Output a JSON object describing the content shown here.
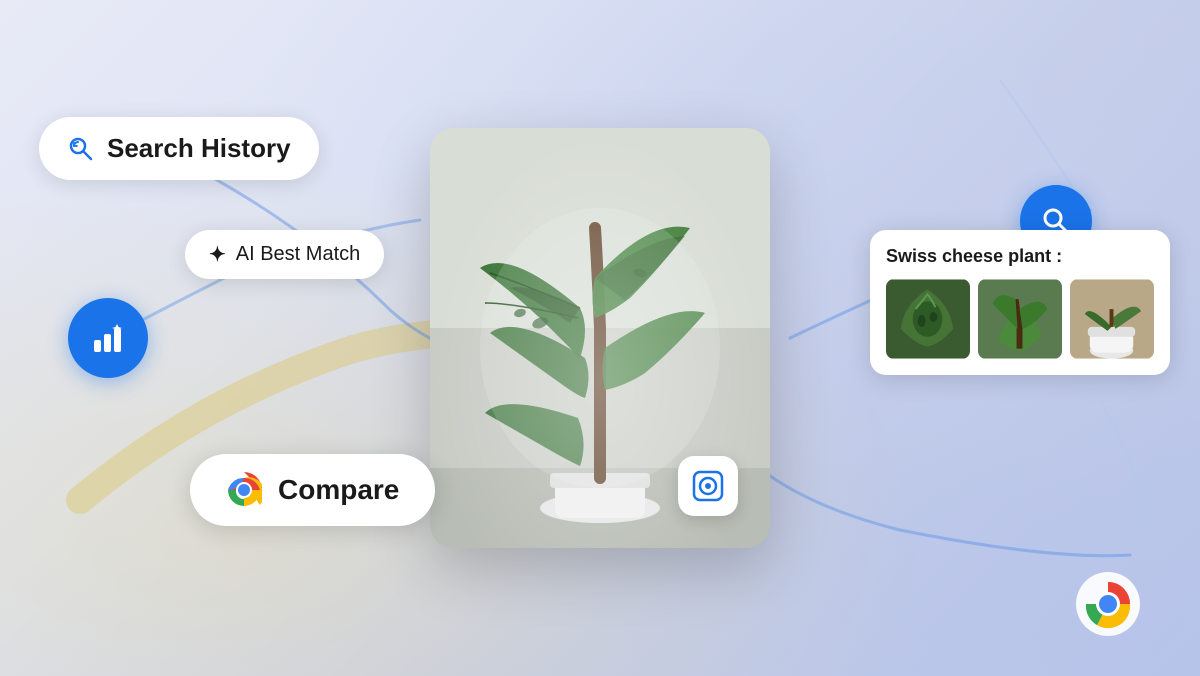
{
  "background": {
    "colors": {
      "primary": "#dde3f5",
      "secondary": "#c5cde8",
      "accent_warm": "rgba(232,220,170,0.45)",
      "accent_blue": "#1a73e8"
    }
  },
  "search_history_pill": {
    "label": "Search History",
    "icon": "search-history-icon"
  },
  "ai_best_match_pill": {
    "label": "AI Best Match",
    "icon": "sparkle-icon"
  },
  "compare_pill": {
    "label": "Compare",
    "icon": "chrome-logo-icon"
  },
  "plant_card": {
    "title": "Swiss cheese plant :",
    "images": [
      "plant-thumb-1",
      "plant-thumb-2",
      "plant-thumb-3"
    ]
  },
  "icons": {
    "charts": "📊",
    "search": "🔍",
    "lens": "📷",
    "sparkle": "✦",
    "search_history": "↺"
  }
}
